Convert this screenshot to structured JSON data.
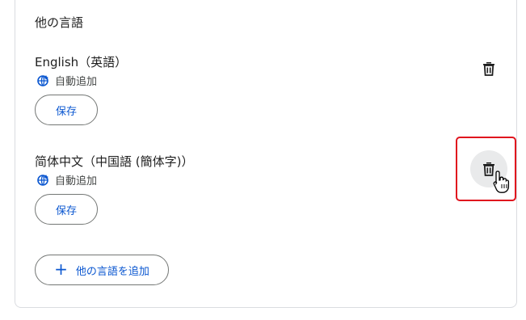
{
  "section": {
    "title": "他の言語"
  },
  "languages": [
    {
      "name": "English（英語）",
      "auto_label": "自動追加",
      "save_label": "保存",
      "delete_icon": "trash-icon"
    },
    {
      "name": "简体中文（中国語 (簡体字)）",
      "auto_label": "自動追加",
      "save_label": "保存",
      "delete_icon": "trash-icon"
    }
  ],
  "add_button": {
    "label": "他の言語を追加",
    "icon": "plus-icon"
  },
  "colors": {
    "accent": "#0b57d0",
    "highlight": "#e0141e",
    "text": "#1f1f1f",
    "border": "#747775"
  }
}
